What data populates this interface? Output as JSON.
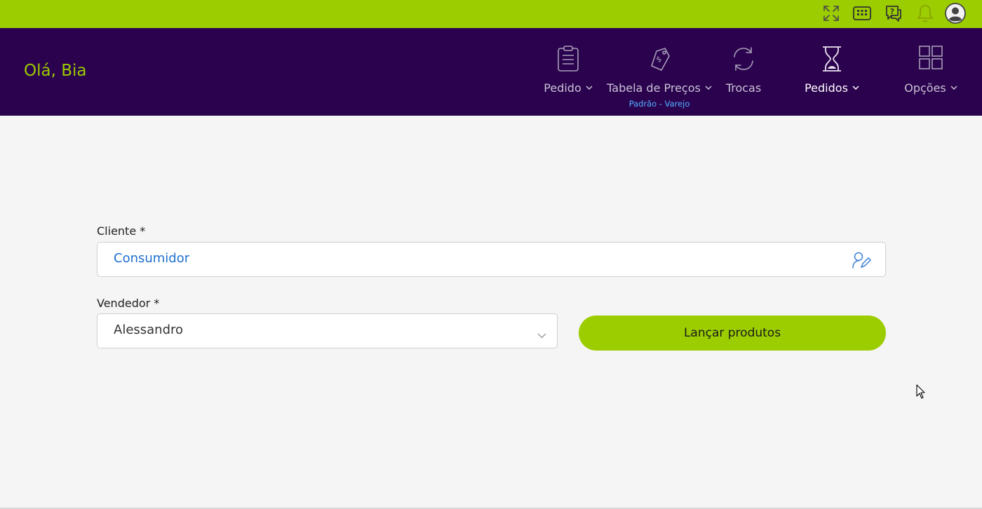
{
  "topbar": {
    "icons": [
      "fullscreen-icon",
      "keypad-icon",
      "help-chat-icon",
      "bell-icon",
      "user-avatar-icon"
    ],
    "colors": {
      "bar": "#9bcd00"
    }
  },
  "header": {
    "greeting": "Olá, Bia",
    "colors": {
      "background": "#2b024e",
      "greeting": "#9bcd00",
      "sub_label": "#4fb3ff"
    },
    "nav": [
      {
        "label": "Pedido",
        "icon": "clipboard-icon",
        "dropdown": true
      },
      {
        "label": "Tabela de Preços",
        "icon": "price-tag-icon",
        "dropdown": true,
        "sub_label": "Padrão - Varejo"
      },
      {
        "label": "Trocas",
        "icon": "refresh-icon",
        "dropdown": false
      },
      {
        "label": "Pedidos",
        "icon": "hourglass-icon",
        "dropdown": true,
        "active": true
      },
      {
        "label": "Opções",
        "icon": "grid-icon",
        "dropdown": true
      }
    ]
  },
  "form": {
    "cliente": {
      "label": "Cliente *",
      "value": "Consumidor",
      "icon": "user-edit-icon"
    },
    "vendedor": {
      "label": "Vendedor *",
      "value": "Alessandro",
      "icon": "chevron-down-icon"
    },
    "submit_label": "Lançar produtos",
    "colors": {
      "button": "#9bcd00",
      "cliente_value": "#1f6fd1"
    }
  }
}
